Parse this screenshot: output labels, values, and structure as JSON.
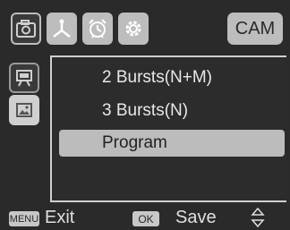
{
  "top_bar": {
    "icons": [
      "camera-icon",
      "network-icon",
      "alarm-clock-icon",
      "gear-icon"
    ],
    "mode_badge": "CAM"
  },
  "side_bar": {
    "icons": [
      "slideshow-icon",
      "picture-icon"
    ]
  },
  "menu": {
    "items": [
      {
        "label": "2 Bursts(N+M)"
      },
      {
        "label": "3 Bursts(N)"
      },
      {
        "label": "Program"
      }
    ]
  },
  "bottom_bar": {
    "menu_key": "MENU",
    "exit_label": "Exit",
    "ok_key": "OK",
    "save_label": "Save",
    "updown_icon": "up-down-arrows-icon"
  },
  "colors": {
    "background": "#2a2a2a",
    "highlight": "#bcbcbc",
    "text": "#e8e8e8"
  }
}
